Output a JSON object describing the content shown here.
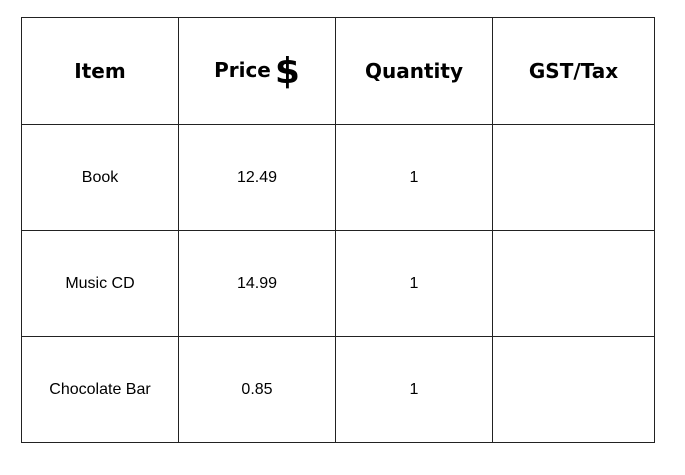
{
  "table": {
    "headers": {
      "item": "Item",
      "price": "Price",
      "price_symbol": "$",
      "quantity": "Quantity",
      "tax": "GST/Tax"
    },
    "rows": [
      {
        "item": "Book",
        "price": "12.49",
        "quantity": "1",
        "tax": ""
      },
      {
        "item": "Music CD",
        "price": "14.99",
        "quantity": "1",
        "tax": ""
      },
      {
        "item": "Chocolate Bar",
        "price": "0.85",
        "quantity": "1",
        "tax": ""
      }
    ]
  }
}
